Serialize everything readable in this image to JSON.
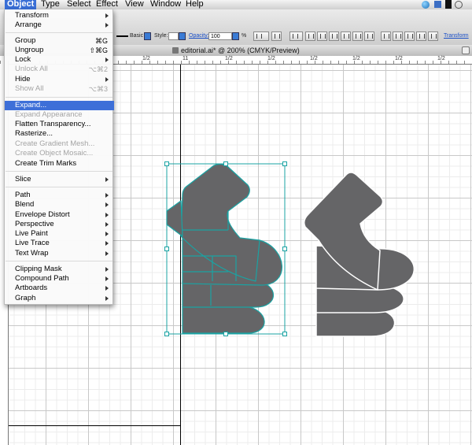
{
  "menubar": {
    "items": [
      "Object",
      "Type",
      "Select",
      "Effect",
      "View",
      "Window",
      "Help"
    ],
    "active": "Object"
  },
  "control_bar": {
    "stroke_style_label": "Basic",
    "style_label": "Style:",
    "opacity_label": "Opacity:",
    "opacity_value": "100",
    "opacity_unit": "%",
    "transform_link": "Transform"
  },
  "document": {
    "title": "editorial.ai* @ 200% (CMYK/Preview)"
  },
  "rulers": {
    "h_labels": [
      "1/2",
      "11",
      "1/2",
      "1/2",
      "1/2",
      "1/2",
      "1/2",
      "1/2"
    ]
  },
  "object_menu": {
    "items": [
      {
        "label": "Transform",
        "shortcut": "",
        "submenu": true,
        "disabled": false
      },
      {
        "label": "Arrange",
        "shortcut": "",
        "submenu": true,
        "disabled": false
      },
      {
        "label": "Group",
        "shortcut": "⌘G",
        "submenu": false,
        "disabled": false
      },
      {
        "label": "Ungroup",
        "shortcut": "⇧⌘G",
        "submenu": false,
        "disabled": false
      },
      {
        "label": "Lock",
        "shortcut": "",
        "submenu": true,
        "disabled": false
      },
      {
        "label": "Unlock All",
        "shortcut": "⌥⌘2",
        "submenu": false,
        "disabled": true
      },
      {
        "label": "Hide",
        "shortcut": "",
        "submenu": true,
        "disabled": false
      },
      {
        "label": "Show All",
        "shortcut": "⌥⌘3",
        "submenu": false,
        "disabled": true
      },
      {
        "label": "Expand...",
        "shortcut": "",
        "submenu": false,
        "disabled": false,
        "highlighted": true
      },
      {
        "label": "Expand Appearance",
        "shortcut": "",
        "submenu": false,
        "disabled": true
      },
      {
        "label": "Flatten Transparency...",
        "shortcut": "",
        "submenu": false,
        "disabled": false
      },
      {
        "label": "Rasterize...",
        "shortcut": "",
        "submenu": false,
        "disabled": false
      },
      {
        "label": "Create Gradient Mesh...",
        "shortcut": "",
        "submenu": false,
        "disabled": true
      },
      {
        "label": "Create Object Mosaic...",
        "shortcut": "",
        "submenu": false,
        "disabled": true
      },
      {
        "label": "Create Trim Marks",
        "shortcut": "",
        "submenu": false,
        "disabled": false
      },
      {
        "label": "Slice",
        "shortcut": "",
        "submenu": true,
        "disabled": false
      },
      {
        "label": "Path",
        "shortcut": "",
        "submenu": true,
        "disabled": false
      },
      {
        "label": "Blend",
        "shortcut": "",
        "submenu": true,
        "disabled": false
      },
      {
        "label": "Envelope Distort",
        "shortcut": "",
        "submenu": true,
        "disabled": false
      },
      {
        "label": "Perspective",
        "shortcut": "",
        "submenu": true,
        "disabled": false
      },
      {
        "label": "Live Paint",
        "shortcut": "",
        "submenu": true,
        "disabled": false
      },
      {
        "label": "Live Trace",
        "shortcut": "",
        "submenu": true,
        "disabled": false
      },
      {
        "label": "Text Wrap",
        "shortcut": "",
        "submenu": true,
        "disabled": false
      },
      {
        "label": "Clipping Mask",
        "shortcut": "",
        "submenu": true,
        "disabled": false
      },
      {
        "label": "Compound Path",
        "shortcut": "",
        "submenu": true,
        "disabled": false
      },
      {
        "label": "Artboards",
        "shortcut": "",
        "submenu": true,
        "disabled": false
      },
      {
        "label": "Graph",
        "shortcut": "",
        "submenu": true,
        "disabled": false
      }
    ]
  },
  "colors": {
    "menu_highlight": "#3d6fd8",
    "shape_fill": "#656567",
    "selection": "#1aa3a3"
  },
  "icons": {
    "status": [
      "globe-icon",
      "dropbox-icon",
      "notification-icon",
      "time-machine-icon"
    ]
  }
}
